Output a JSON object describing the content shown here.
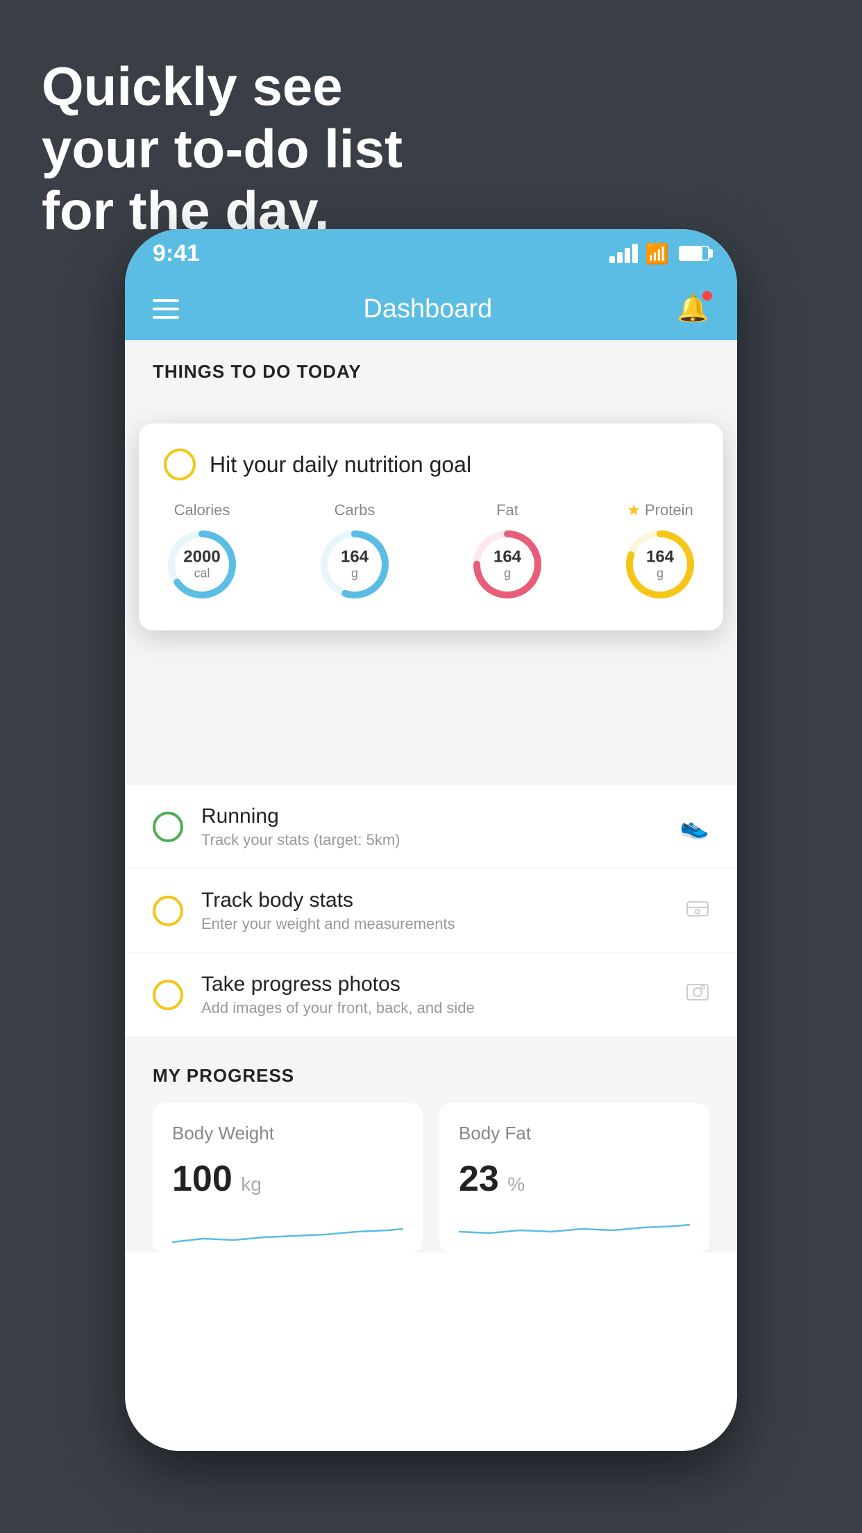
{
  "headline": {
    "line1": "Quickly see",
    "line2": "your to-do list",
    "line3": "for the day."
  },
  "status_bar": {
    "time": "9:41",
    "signal": "signal",
    "wifi": "wifi",
    "battery": "battery"
  },
  "header": {
    "title": "Dashboard"
  },
  "section": {
    "things_today": "THINGS TO DO TODAY"
  },
  "nutrition_card": {
    "title": "Hit your daily nutrition goal",
    "stats": [
      {
        "label": "Calories",
        "value": "2000",
        "unit": "cal",
        "color": "#5bbde4",
        "percent": 65
      },
      {
        "label": "Carbs",
        "value": "164",
        "unit": "g",
        "color": "#5bbde4",
        "percent": 55
      },
      {
        "label": "Fat",
        "value": "164",
        "unit": "g",
        "color": "#e85d7a",
        "percent": 75
      },
      {
        "label": "Protein",
        "value": "164",
        "unit": "g",
        "color": "#f5c518",
        "percent": 80,
        "star": true
      }
    ]
  },
  "todo_items": [
    {
      "name": "Running",
      "sub": "Track your stats (target: 5km)",
      "circle_color": "green",
      "icon": "shoe"
    },
    {
      "name": "Track body stats",
      "sub": "Enter your weight and measurements",
      "circle_color": "yellow",
      "icon": "scale"
    },
    {
      "name": "Take progress photos",
      "sub": "Add images of your front, back, and side",
      "circle_color": "yellow",
      "icon": "photo"
    }
  ],
  "progress": {
    "title": "MY PROGRESS",
    "cards": [
      {
        "title": "Body Weight",
        "value": "100",
        "unit": "kg"
      },
      {
        "title": "Body Fat",
        "value": "23",
        "unit": "%"
      }
    ]
  }
}
